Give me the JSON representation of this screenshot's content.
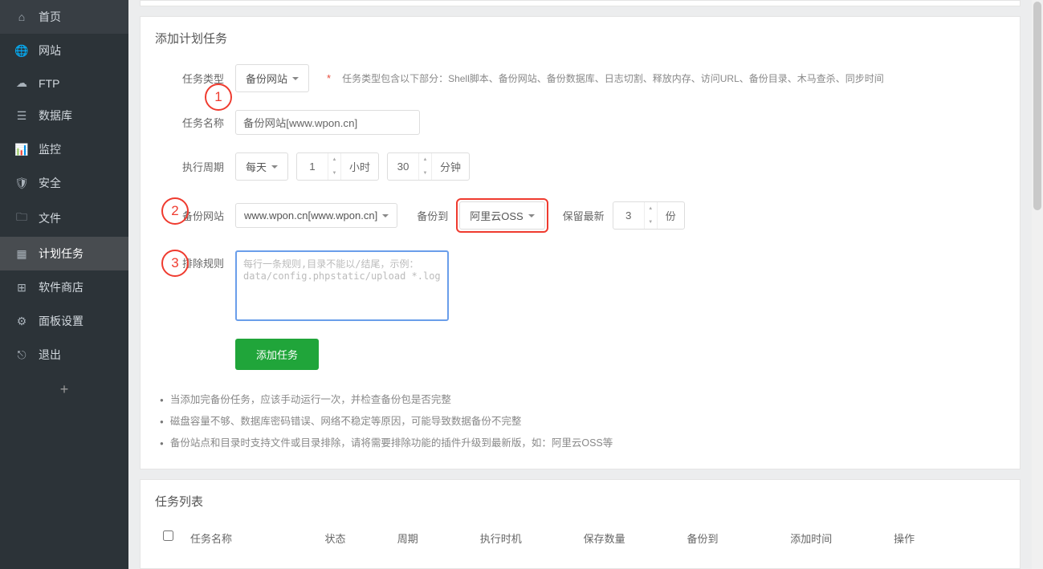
{
  "sidebar": {
    "items": [
      {
        "icon": "home",
        "label": "首页"
      },
      {
        "icon": "globe",
        "label": "网站"
      },
      {
        "icon": "ftp",
        "label": "FTP"
      },
      {
        "icon": "db",
        "label": "数据库"
      },
      {
        "icon": "monitor",
        "label": "监控"
      },
      {
        "icon": "shield",
        "label": "安全"
      },
      {
        "icon": "folder",
        "label": "文件"
      },
      {
        "icon": "calendar",
        "label": "计划任务"
      },
      {
        "icon": "grid",
        "label": "软件商店"
      },
      {
        "icon": "gear",
        "label": "面板设置"
      },
      {
        "icon": "exit",
        "label": "退出"
      }
    ],
    "plus": "+"
  },
  "form": {
    "title": "添加计划任务",
    "labels": {
      "task_type": "任务类型",
      "task_name": "任务名称",
      "cycle": "执行周期",
      "backup_site": "备份网站",
      "backup_to": "备份到",
      "keep_latest": "保留最新",
      "exclude_rule": "排除规则"
    },
    "task_type_value": "备份网站",
    "task_type_hint_star": "*",
    "task_type_hint": "任务类型包含以下部分：Shell脚本、备份网站、备份数据库、日志切割、释放内存、访问URL、备份目录、木马查杀、同步时间",
    "task_name_value": "备份网站[www.wpon.cn]",
    "cycle_value": "每天",
    "hour_value": "1",
    "hour_unit": "小时",
    "minute_value": "30",
    "minute_unit": "分钟",
    "site_value": "www.wpon.cn[www.wpon.cn]",
    "dest_value": "阿里云OSS",
    "keep_value": "3",
    "keep_unit": "份",
    "exclude_placeholder": "每行一条规则,目录不能以/结尾，示例：\ndata/config.phpstatic/upload *.log",
    "submit": "添加任务",
    "notes": [
      "当添加完备份任务，应该手动运行一次，并检查备份包是否完整",
      "磁盘容量不够、数据库密码错误、网络不稳定等原因，可能导致数据备份不完整",
      "备份站点和目录时支持文件或目录排除，请将需要排除功能的插件升级到最新版，如：阿里云OSS等"
    ]
  },
  "list": {
    "title": "任务列表",
    "columns": [
      "任务名称",
      "状态",
      "周期",
      "执行时机",
      "保存数量",
      "备份到",
      "添加时间",
      "操作"
    ]
  },
  "annotations": {
    "a1": "1",
    "a2": "2",
    "a3": "3"
  }
}
